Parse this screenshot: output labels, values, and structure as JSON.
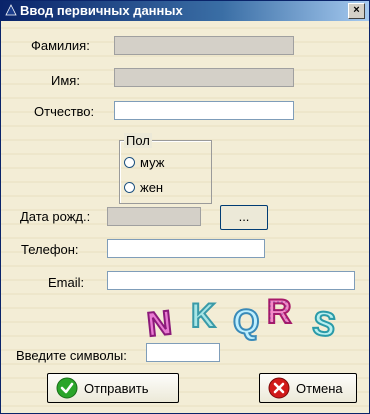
{
  "window": {
    "title": "Ввод первичных данных",
    "close_label": "×"
  },
  "form": {
    "surname_label": "Фамилия:",
    "name_label": "Имя:",
    "patronymic_label": "Отчество:",
    "gender_group_label": "Пол",
    "gender_options": [
      "муж",
      "жен"
    ],
    "birthdate_label": "Дата рожд.:",
    "birthdate_button_label": "...",
    "phone_label": "Телефон:",
    "email_label": "Email:",
    "captcha_label": "Введите символы:",
    "captcha_text": "NKQRS",
    "surname_value": "",
    "name_value": "",
    "patronymic_value": "",
    "birthdate_value": "",
    "phone_value": "",
    "email_value": "",
    "captcha_value": ""
  },
  "buttons": {
    "send_label": "Отправить",
    "cancel_label": "Отмена"
  },
  "colors": {
    "titlebar_start": "#0a246a",
    "titlebar_end": "#a6caf0",
    "ok_green": "#2aa52a",
    "cancel_red": "#d11a1a"
  }
}
